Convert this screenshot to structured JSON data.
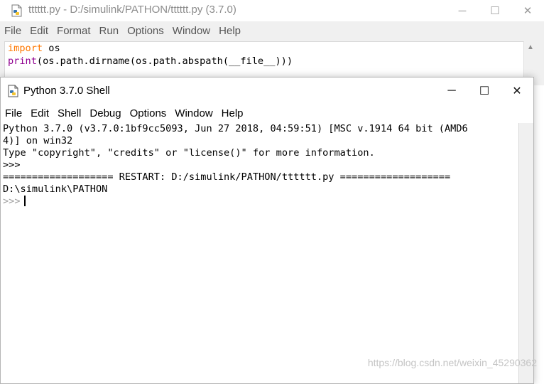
{
  "editor_window": {
    "title": "tttttt.py - D:/simulink/PATHON/tttttt.py (3.7.0)",
    "menu": [
      "File",
      "Edit",
      "Format",
      "Run",
      "Options",
      "Window",
      "Help"
    ],
    "code_lines": [
      {
        "keyword": "import",
        "rest": " os"
      },
      {
        "keyword": "print",
        "rest": "(os.path.dirname(os.path.abspath(__file__)))"
      }
    ]
  },
  "shell_window": {
    "title": "Python 3.7.0 Shell",
    "menu": [
      "File",
      "Edit",
      "Shell",
      "Debug",
      "Options",
      "Window",
      "Help"
    ],
    "console": {
      "banner_line1": "Python 3.7.0 (v3.7.0:1bf9cc5093, Jun 27 2018, 04:59:51) [MSC v.1914 64 bit (AMD6",
      "banner_line2": "4)] on win32",
      "banner_line3": "Type \"copyright\", \"credits\" or \"license()\" for more information.",
      "prompt": ">>>",
      "restart_line": "=================== RESTART: D:/simulink/PATHON/tttttt.py ===================",
      "output_line": "D:\\simulink\\PATHON"
    }
  },
  "window_controls": {
    "minimize": "─",
    "maximize": "☐",
    "close": "✕"
  },
  "watermark": "https://blog.csdn.net/weixin_45290362",
  "colors": {
    "keyword": "#ff7700",
    "builtin": "#900090",
    "stdout": "#0000c0",
    "prompt": "#a0a0a0"
  },
  "icons": [
    "python-file-icon",
    "python-shell-icon",
    "minimize-icon",
    "maximize-icon",
    "close-icon",
    "scroll-up-arrow-icon"
  ]
}
